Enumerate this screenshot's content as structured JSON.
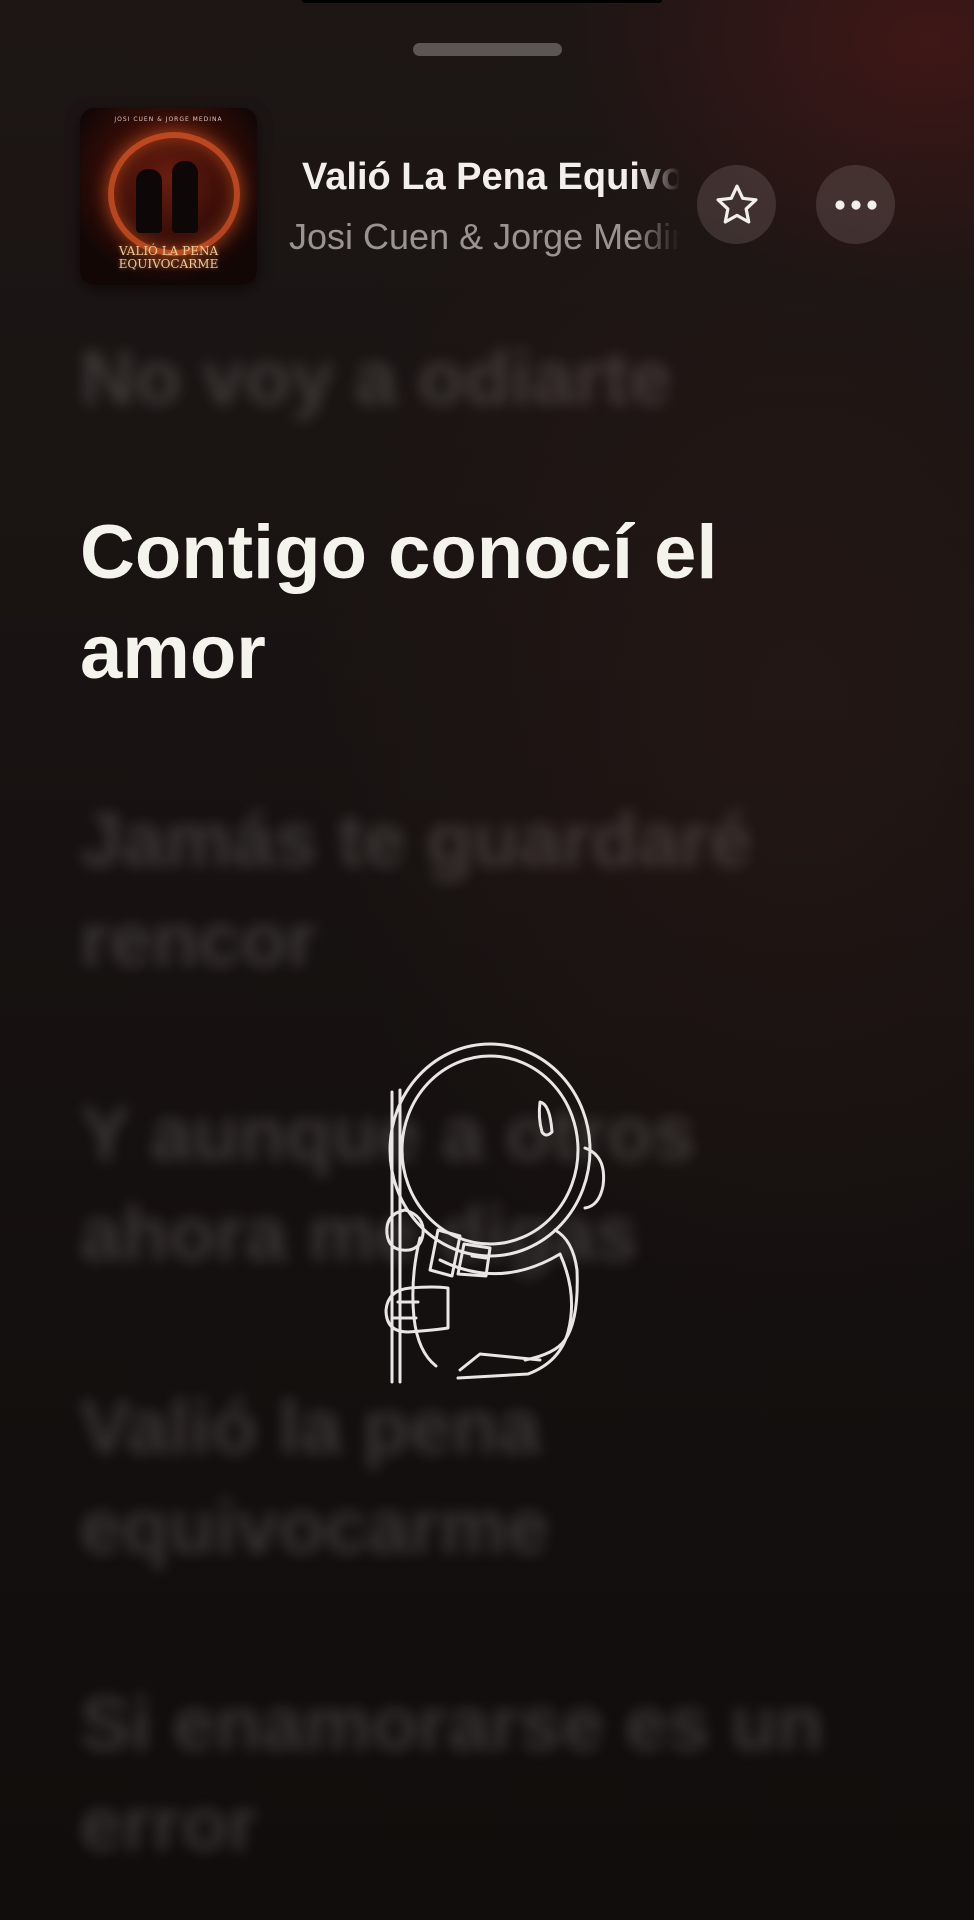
{
  "header": {
    "title": "Valió La Pena Equivocarme",
    "artist": "Josi Cuen & Jorge Medina",
    "artwork": {
      "top_text": "JOSI CUEN & JORGE MEDINA",
      "title_line1": "VALIÓ LA PENA",
      "title_line2": "EQUIVOCARME"
    },
    "favorite_icon": "star-icon",
    "more_icon": "ellipsis-icon"
  },
  "lyrics": {
    "lines": [
      "No voy a odiarte",
      "Contigo conocí el amor",
      "Jamás te guardaré rencor",
      "Y aunque a otros ahora me digas",
      "Valió la pena equivocarme",
      "Si enamorarse es un error"
    ],
    "active_index": 1
  },
  "overlay": {
    "icon": "astronaut-sticker"
  },
  "colors": {
    "background": "#141010",
    "accent_glow": "#5a1818",
    "active_lyric": "#f4f3ec",
    "secondary_text": "#9b9391"
  }
}
